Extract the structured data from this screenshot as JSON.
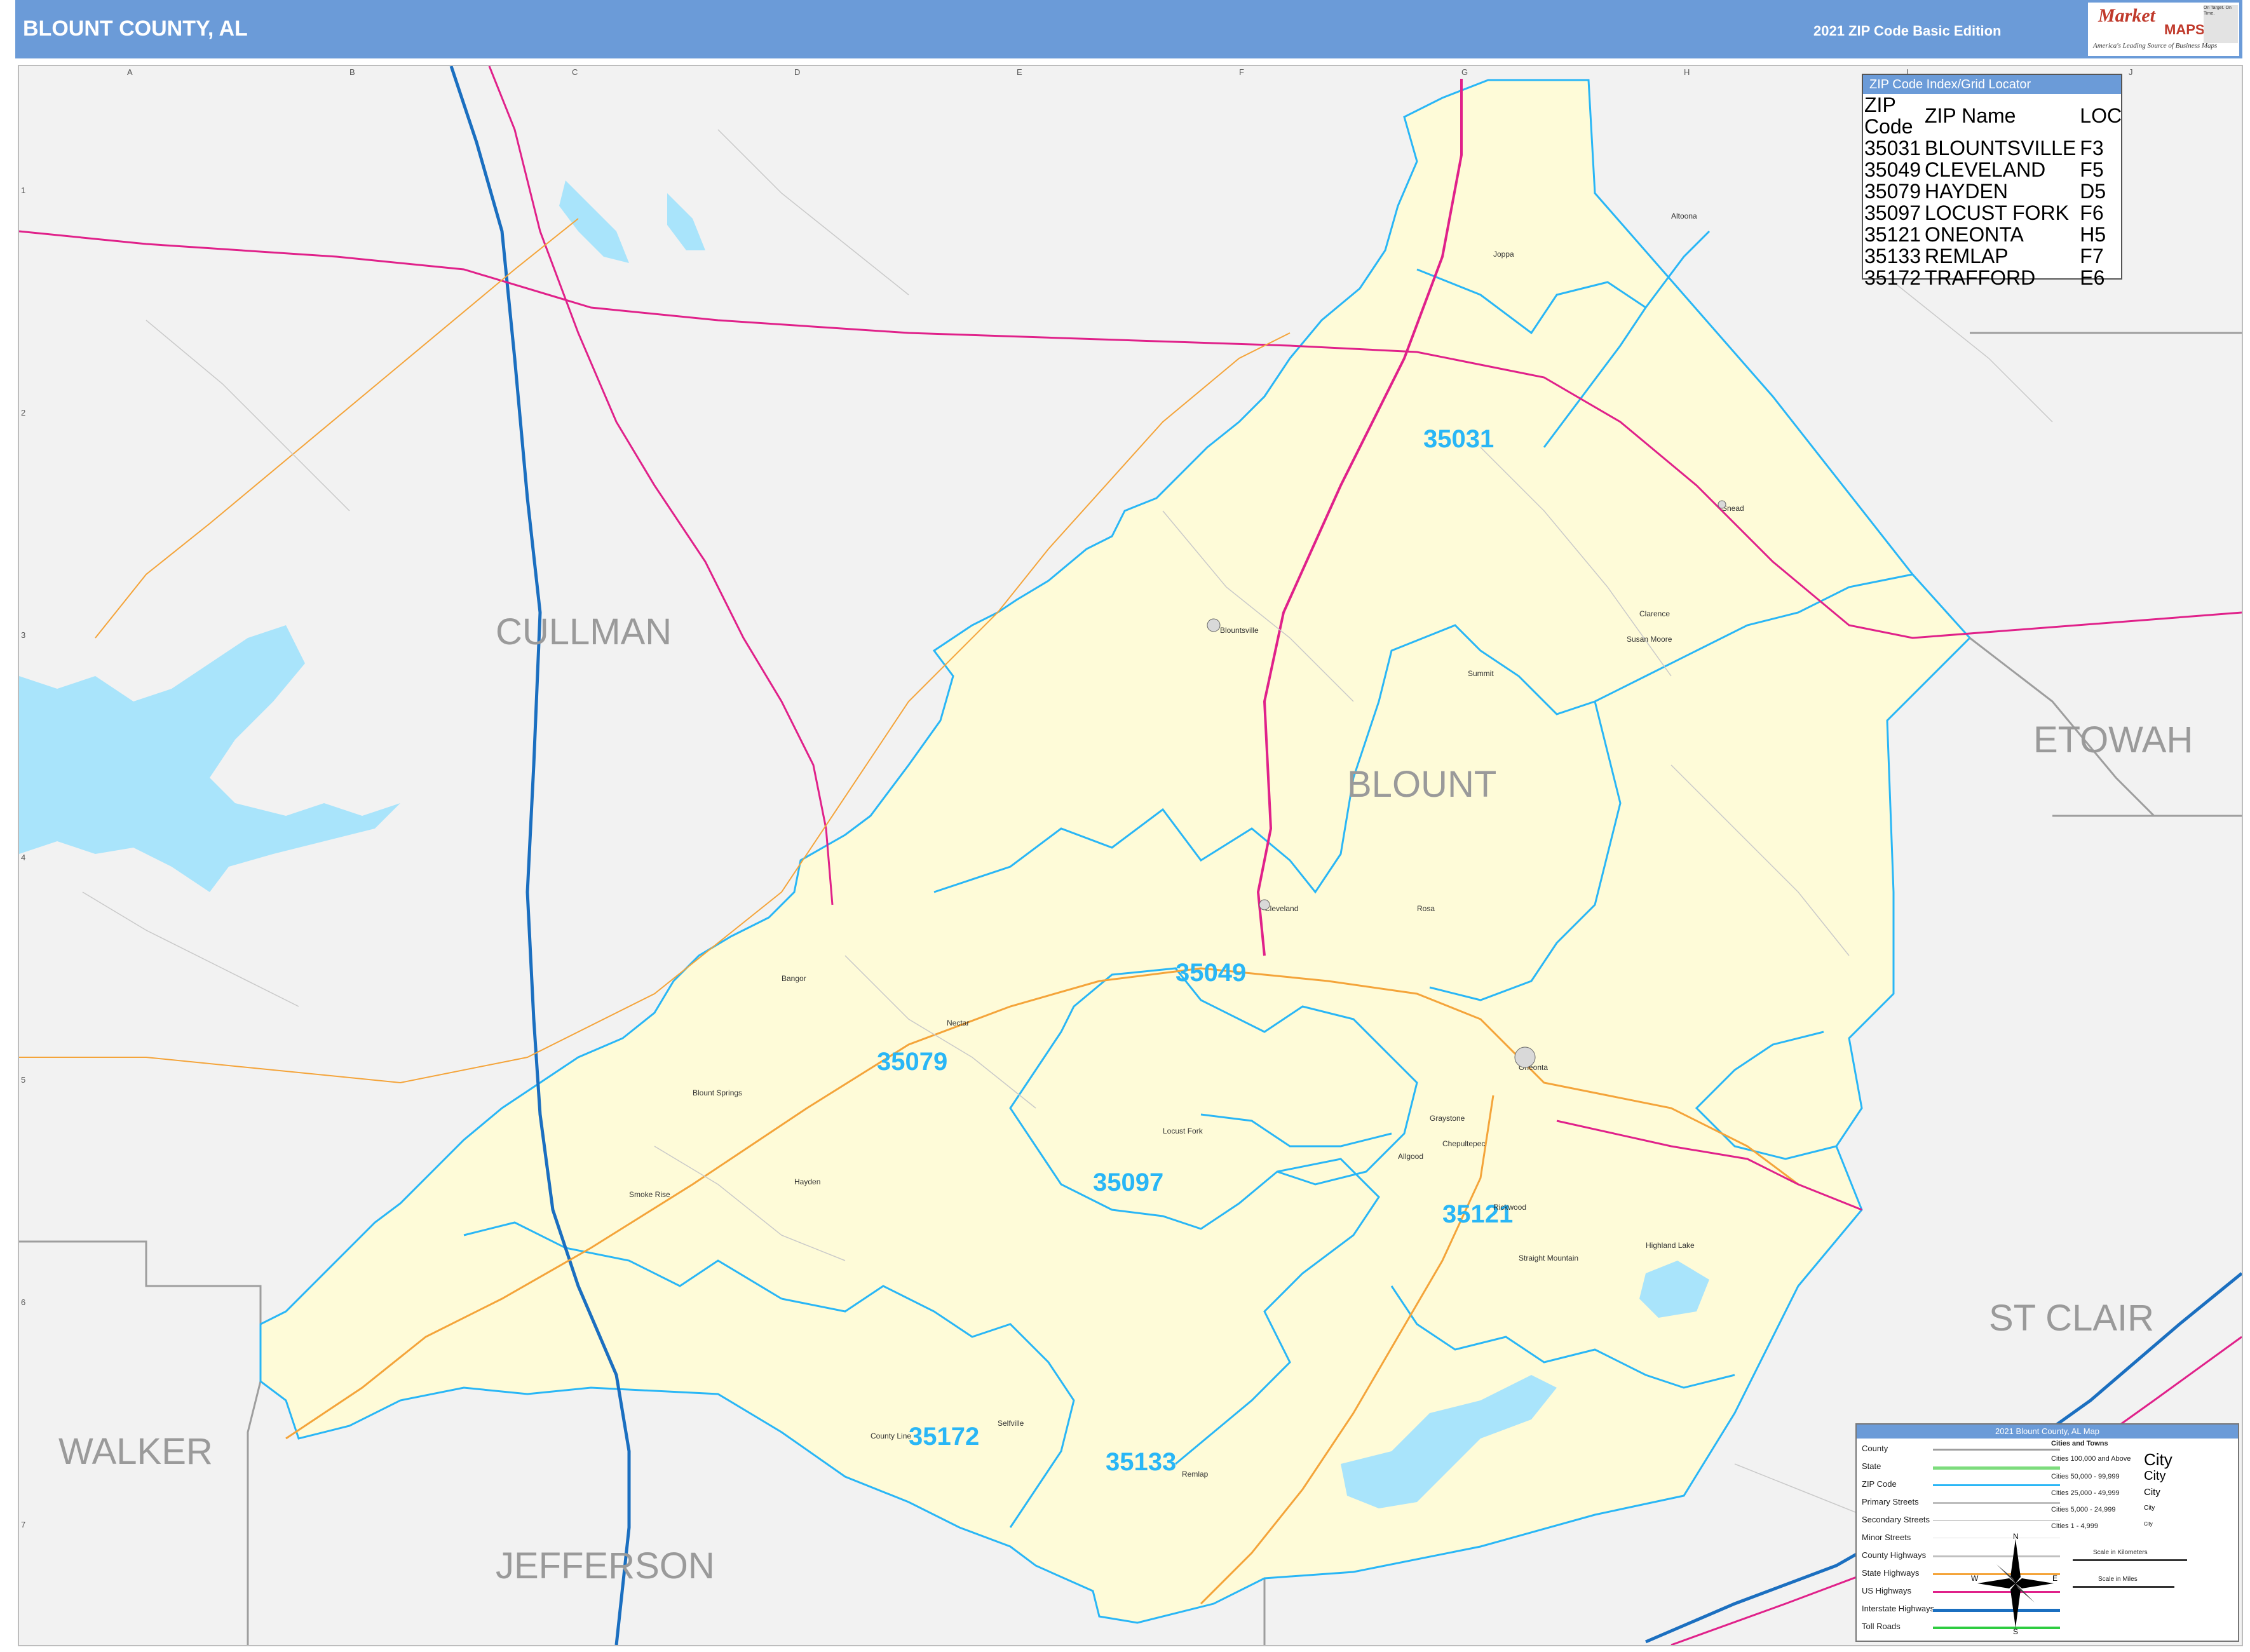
{
  "header": {
    "title": "BLOUNT COUNTY, AL",
    "edition": "2021 ZIP Code Basic Edition",
    "logo_brand_top": "Market",
    "logo_brand_bottom": "MAPS",
    "logo_tagline": "America's Leading Source of Business Maps",
    "logo_tagline_2": "On Target. On Time."
  },
  "colors": {
    "header_bar": "#6b9bd8",
    "county_fill": "#fefbd8",
    "outside_fill": "#f2f2f2",
    "zip_boundary": "#29b6f6",
    "us_highway": "#e0218a",
    "interstate": "#1b6fc0",
    "state_highway": "#f4a43a",
    "water": "#a9e4fb"
  },
  "zip_index": {
    "header": "ZIP Code Index/Grid Locator",
    "columns": [
      "ZIP Code",
      "ZIP Name",
      "LOC"
    ],
    "rows": [
      [
        "35031",
        "BLOUNTSVILLE",
        "F3"
      ],
      [
        "35049",
        "CLEVELAND",
        "F5"
      ],
      [
        "35079",
        "HAYDEN",
        "D5"
      ],
      [
        "35097",
        "LOCUST FORK",
        "F6"
      ],
      [
        "35121",
        "ONEONTA",
        "H5"
      ],
      [
        "35133",
        "REMLAP",
        "F7"
      ],
      [
        "35172",
        "TRAFFORD",
        "E6"
      ]
    ]
  },
  "map_labels": {
    "counties": [
      "CULLMAN",
      "BLOUNT",
      "ETOWAH",
      "ST CLAIR",
      "WALKER",
      "JEFFERSON"
    ],
    "zips": [
      "35031",
      "35049",
      "35079",
      "35097",
      "35121",
      "35133",
      "35172"
    ],
    "places": [
      "Blountsville",
      "Cleveland",
      "Hayden",
      "Locust Fork",
      "Oneonta",
      "Remlap",
      "Snead",
      "Susan Moore",
      "Altoona",
      "Blount Springs",
      "Smoke Rise",
      "Highland Lake",
      "Nectar",
      "Rosa",
      "Allgood",
      "Chepultepec",
      "County Line",
      "Selfville",
      "Graystone",
      "Clarence",
      "Bangor",
      "Joppa",
      "Summit",
      "Rickwood",
      "Straight Mountain"
    ]
  },
  "grid": {
    "columns": [
      "A",
      "B",
      "C",
      "D",
      "E",
      "F",
      "G",
      "H",
      "I",
      "J"
    ],
    "rows": [
      "1",
      "2",
      "3",
      "4",
      "5",
      "6",
      "7"
    ]
  },
  "legend": {
    "title": "2021 Blount County, AL Map",
    "items": [
      "County",
      "State",
      "ZIP Code",
      "Primary Streets",
      "Secondary Streets",
      "Minor Streets",
      "County Highways",
      "State Highways",
      "US Highways",
      "Interstate Highways",
      "Toll Roads"
    ],
    "cities_title": "Cities and Towns",
    "cities": [
      "Cities 100,000 and Above",
      "Cities 50,000 - 99,999",
      "Cities 25,000 - 49,999",
      "Cities 5,000 - 24,999",
      "Cities 1 - 4,999"
    ],
    "city_symbol": "City",
    "scale_km": "Scale in Kilometers",
    "scale_mi": "Scale in Miles",
    "compass": [
      "N",
      "S",
      "E",
      "W"
    ]
  }
}
